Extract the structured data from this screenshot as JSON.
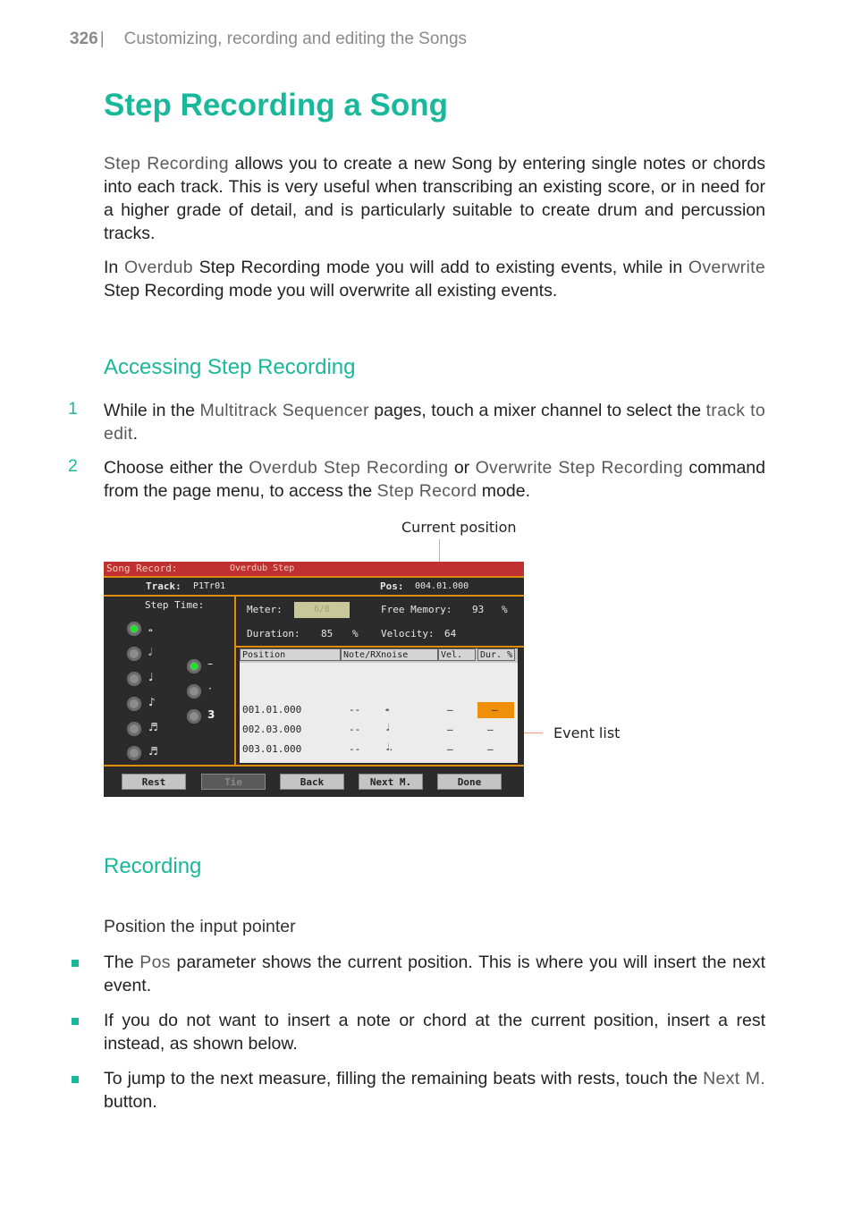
{
  "header": {
    "page_number": "326",
    "separator": "|",
    "chapter": "Customizing, recording and editing the Songs"
  },
  "title": "Step Recording a Song",
  "intro": {
    "p1": {
      "kw": "Step Recording",
      "text": " allows you to create a new Song by entering single notes or chords into each track. This is very useful when transcribing an existing score, or in need for a higher grade of detail, and is particularly suitable to create drum and percussion tracks."
    },
    "p2": {
      "a": "In ",
      "kw1": "Overdub",
      "b": " Step Recording mode you will add to existing events, while in ",
      "kw2": "Overwrite",
      "c": " Step Recording mode you will overwrite all existing events."
    }
  },
  "section1": {
    "heading": "Accessing Step Recording",
    "steps": [
      {
        "n": "1",
        "a": "While in the ",
        "kw1": "Multitrack Sequencer",
        "b": " pages, touch a mixer channel to select the ",
        "kw2": "track to edit",
        "c": "."
      },
      {
        "n": "2",
        "a": "Choose either the ",
        "kw1": "Overdub Step Recording",
        "b": " or ",
        "kw2": "Overwrite Step Recording",
        "c": " command from the page menu, to access the ",
        "kw3": "Step Record",
        "d": " mode."
      }
    ]
  },
  "figure": {
    "annotations": {
      "current_position": "Current position",
      "event_list": "Event list"
    },
    "screen": {
      "title_left": "Song Record:",
      "title_mode": "Overdub Step",
      "track_label": "Track:",
      "track_value": "P1Tr01",
      "pos_label": "Pos:",
      "pos_value": "004.01.000",
      "step_time_label": "Step Time:",
      "step_values": [
        "whole",
        "half",
        "quarter",
        "eighth",
        "sixteenth",
        "thirty-second"
      ],
      "step_selected": "whole",
      "modifiers": [
        "normal",
        "dotted",
        "triplet"
      ],
      "modifier_selected": "normal",
      "meter_label": "Meter:",
      "meter_value": "6/8",
      "free_memory_label": "Free Memory:",
      "free_memory_value": "93",
      "free_memory_unit": "%",
      "duration_label": "Duration:",
      "duration_value": "85",
      "duration_unit": "%",
      "velocity_label": "Velocity:",
      "velocity_value": "64",
      "table_headers": [
        "Position",
        "Note/RXnoise",
        "Vel.",
        "Dur. %"
      ],
      "events": [
        {
          "position": "001.01.000",
          "note": "--",
          "symbol": "whole rest",
          "vel": "–",
          "dur": "–",
          "selected": true
        },
        {
          "position": "002.03.000",
          "note": "--",
          "symbol": "half",
          "vel": "–",
          "dur": "–",
          "selected": false
        },
        {
          "position": "003.01.000",
          "note": "--",
          "symbol": "dotted half",
          "vel": "–",
          "dur": "–",
          "selected": false
        }
      ],
      "buttons": [
        "Rest",
        "Tie",
        "Back",
        "Next M.",
        "Done"
      ],
      "disabled_buttons": [
        "Tie"
      ]
    }
  },
  "section2": {
    "heading": "Recording",
    "subheading": "Position the input pointer",
    "bullets": [
      {
        "a": "The ",
        "kw": "Pos",
        "b": " parameter shows the current position. This is where you will insert the next event."
      },
      {
        "a": "If you do not want to insert a note or chord at the current position, insert a rest instead, as shown below."
      },
      {
        "a": "To jump to the next measure, filling the remaining beats with rests, touch the ",
        "kw": "Next M.",
        "b": " button."
      }
    ]
  },
  "colors": {
    "accent": "#1ab89a",
    "screen_title": "#c03030",
    "screen_border": "#e08a10",
    "selected_cell": "#f0900a"
  }
}
